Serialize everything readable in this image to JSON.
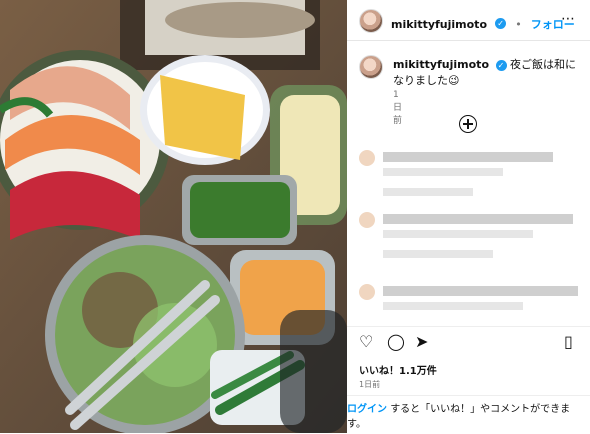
{
  "post": {
    "username": "mikittyfujimoto",
    "verified_mark": "✓",
    "follow_label": "フォロー",
    "more_icon": "more-icon",
    "caption_username": "mikittyfujimoto",
    "caption_text": "夜ご飯は和になりました😉",
    "caption_time": "1日前",
    "likes_text": "いいね！1.1万件",
    "time_ago": "1日前",
    "login_link": "ログイン",
    "login_rest": "すると「いいね！」やコメントができます。"
  }
}
